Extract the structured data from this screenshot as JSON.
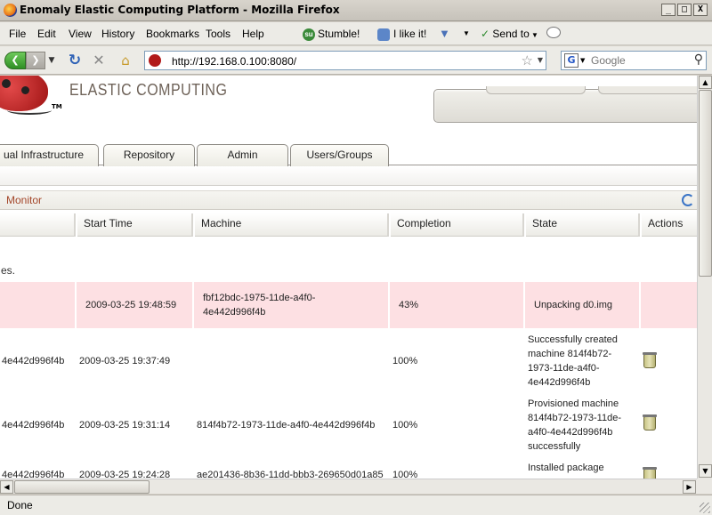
{
  "window": {
    "title": "Enomaly Elastic Computing Platform - Mozilla Firefox",
    "minimize": "_",
    "maximize": "□",
    "close": "X"
  },
  "menu": [
    "File",
    "Edit",
    "View",
    "History",
    "Bookmarks",
    "Tools",
    "Help"
  ],
  "toolbar": {
    "stumble": "Stumble!",
    "su_glyph": "su",
    "like": "I like it!",
    "send_to": "Send to"
  },
  "nav": {
    "url": "http://192.168.0.100:8080/",
    "search_placeholder": "Google",
    "search_engine": "G"
  },
  "header": {
    "brand": "ELASTIC COMPUTING",
    "tm": "TM"
  },
  "tabs": [
    "ual Infrastructure",
    "Repository",
    "Admin",
    "Users/Groups"
  ],
  "monitor": {
    "title": "Monitor"
  },
  "table": {
    "columns": [
      "",
      "Start Time",
      "Machine",
      "Completion",
      "State",
      "Actions"
    ],
    "note": "es.",
    "rows": [
      {
        "id": "",
        "start": "2009-03-25 19:48:59",
        "machine": "fbf12bdc-1975-11de-a4f0-4e442d996f4b",
        "completion": "43%",
        "state": "Unpacking d0.img",
        "highlight": true
      },
      {
        "id": "4e442d996f4b",
        "start": "2009-03-25 19:37:49",
        "machine": "",
        "completion": "100%",
        "state": "Successfully created machine 814f4b72-1973-11de-a4f0-4e442d996f4b",
        "highlight": false
      },
      {
        "id": "4e442d996f4b",
        "start": "2009-03-25 19:31:14",
        "machine": "814f4b72-1973-11de-a4f0-4e442d996f4b",
        "completion": "100%",
        "state": "Provisioned machine 814f4b72-1973-11de-a4f0-4e442d996f4b successfully",
        "highlight": false
      },
      {
        "id": "4e442d996f4b",
        "start": "2009-03-25 19:24:28",
        "machine": "ae201436-8b36-11dd-bbb3-269650d01a85",
        "completion": "100%",
        "state": "Installed package",
        "highlight": false
      }
    ]
  },
  "status": {
    "text": "Done"
  },
  "colors": {
    "highlight_row": "#fde0e3",
    "monitor_title": "#a4472a",
    "accent_blue": "#3a74c6"
  }
}
